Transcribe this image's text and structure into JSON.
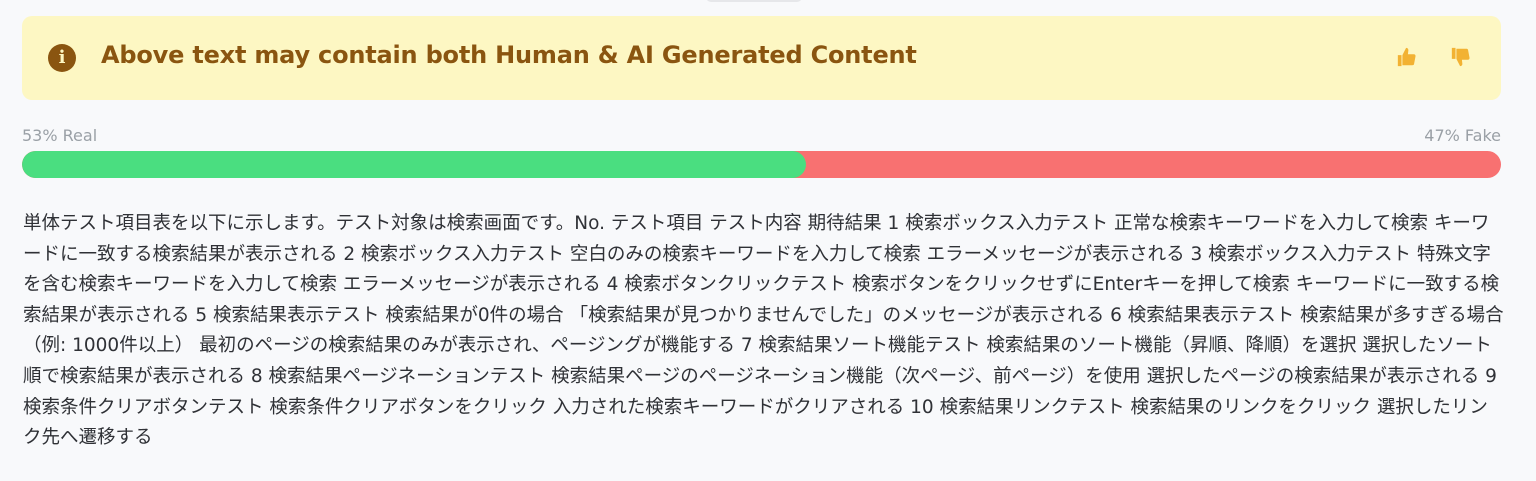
{
  "banner": {
    "info_icon": "info-circle-icon",
    "text": "Above text may contain both Human & AI Generated Content",
    "thumb_up_icon": "thumbs-up-icon",
    "thumb_down_icon": "thumbs-down-icon"
  },
  "result": {
    "real_label": "53% Real",
    "fake_label": "47% Fake",
    "real_fraction": 0.53,
    "fake_fraction": 0.47
  },
  "colors": {
    "banner_bg": "#fdf7c3",
    "banner_text": "#8a5510",
    "real": "#4ade80",
    "fake": "#f87171",
    "thumb": "#f2b233"
  },
  "content": {
    "text": "単体テスト項目表を以下に示します。テスト対象は検索画面です。No. テスト項目 テスト内容 期待結果 1 検索ボックス入力テスト 正常な検索キーワードを入力して検索 キーワードに一致する検索結果が表示される 2 検索ボックス入力テスト 空白のみの検索キーワードを入力して検索 エラーメッセージが表示される 3 検索ボックス入力テスト 特殊文字を含む検索キーワードを入力して検索 エラーメッセージが表示される 4 検索ボタンクリックテスト 検索ボタンをクリックせずにEnterキーを押して検索 キーワードに一致する検索結果が表示される 5 検索結果表示テスト 検索結果が0件の場合 「検索結果が見つかりませんでした」のメッセージが表示される 6 検索結果表示テスト 検索結果が多すぎる場合（例: 1000件以上） 最初のページの検索結果のみが表示され、ページングが機能する 7 検索結果ソート機能テスト 検索結果のソート機能（昇順、降順）を選択 選択したソート順で検索結果が表示される 8 検索結果ページネーションテスト 検索結果ページのページネーション機能（次ページ、前ページ）を使用 選択したページの検索結果が表示される 9 検索条件クリアボタンテスト 検索条件クリアボタンをクリック 入力された検索キーワードがクリアされる 10 検索結果リンクテスト 検索結果のリンクをクリック 選択したリンク先へ遷移する"
  }
}
